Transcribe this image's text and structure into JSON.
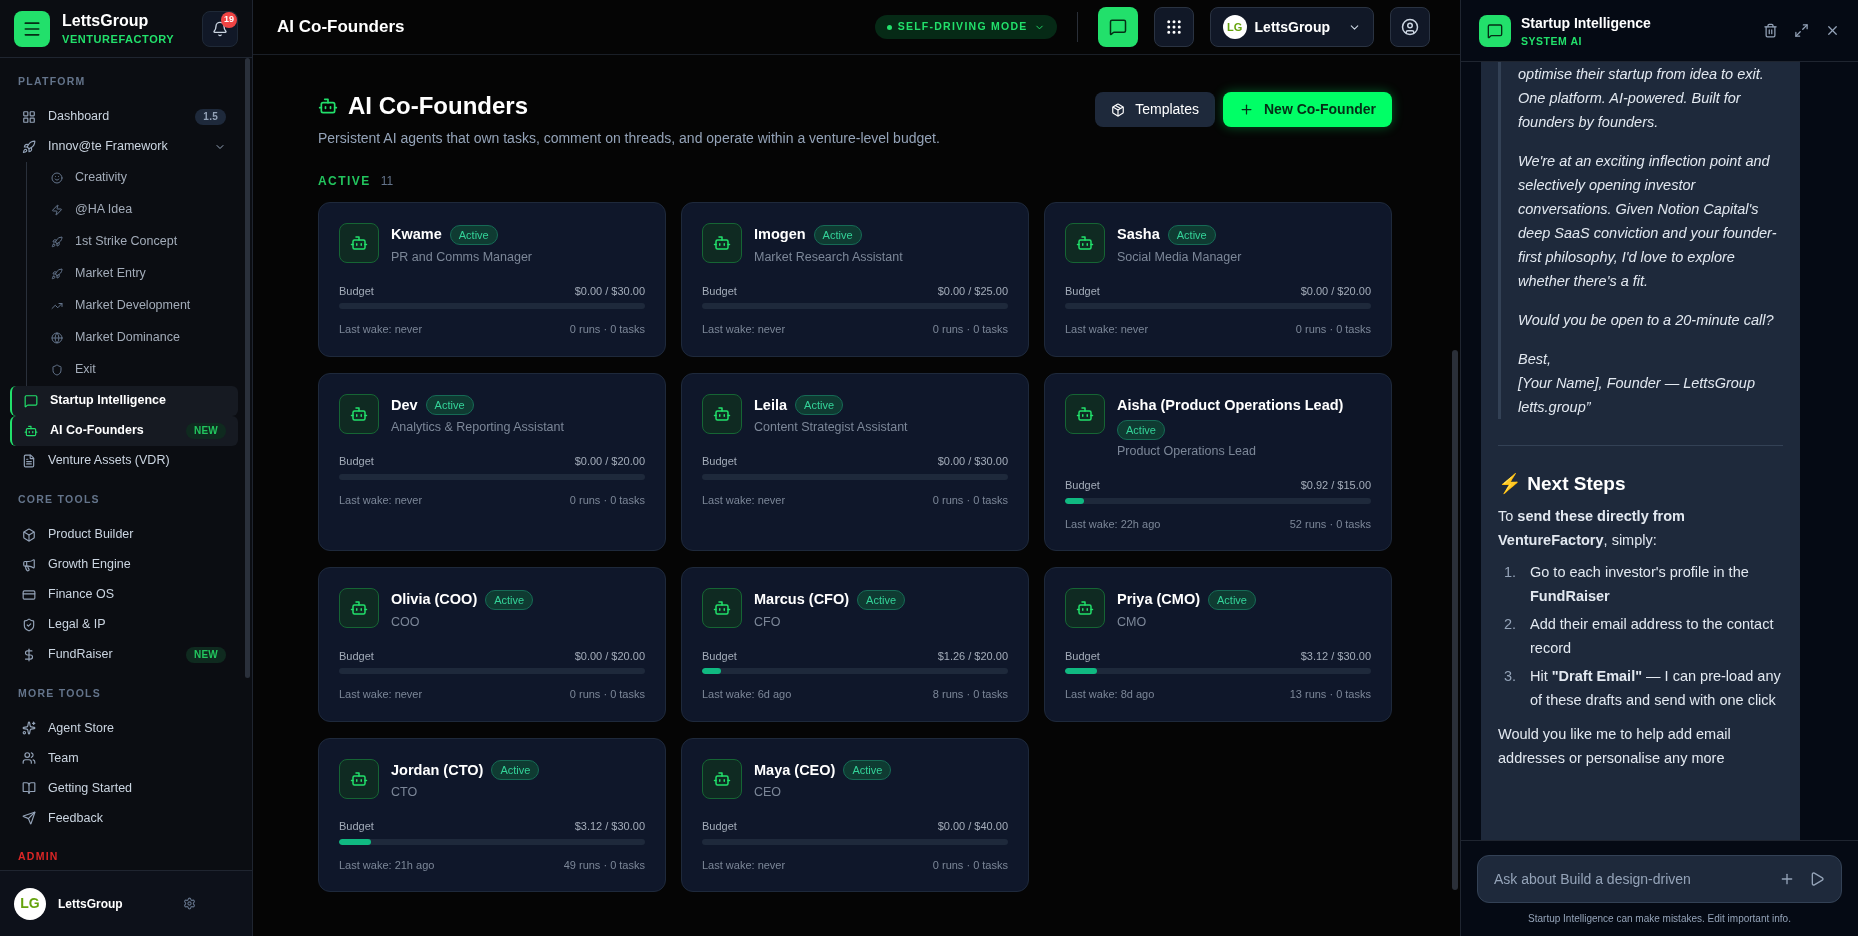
{
  "brand": {
    "name": "LettsGroup",
    "subtitle": "VENTUREFACTORY",
    "notifications": "19"
  },
  "sidebar": {
    "sections": [
      {
        "title": "PLATFORM",
        "color": "#64748b",
        "items": [
          {
            "label": "Dashboard",
            "selected": false,
            "badge": {
              "text": "1.5",
              "kind": "version"
            }
          },
          {
            "label": "Innov@te Framework",
            "selected": false,
            "expanded": true,
            "children": [
              {
                "label": "Creativity"
              },
              {
                "label": "@HA Idea"
              },
              {
                "label": "1st Strike Concept"
              },
              {
                "label": "Market Entry"
              },
              {
                "label": "Market Development"
              },
              {
                "label": "Market Dominance"
              },
              {
                "label": "Exit"
              }
            ]
          },
          {
            "label": "Startup Intelligence",
            "selected": true
          },
          {
            "label": "AI Co-Founders",
            "selected": true,
            "badge": {
              "text": "NEW",
              "kind": "new"
            }
          },
          {
            "label": "Venture Assets (VDR)",
            "selected": false
          }
        ]
      },
      {
        "title": "CORE TOOLS",
        "color": "#64748b",
        "items": [
          {
            "label": "Product Builder",
            "selected": false
          },
          {
            "label": "Growth Engine",
            "selected": false
          },
          {
            "label": "Finance OS",
            "selected": false
          },
          {
            "label": "Legal & IP",
            "selected": false
          },
          {
            "label": "FundRaiser",
            "selected": false,
            "badge": {
              "text": "NEW",
              "kind": "new"
            }
          }
        ]
      },
      {
        "title": "MORE TOOLS",
        "color": "#64748b",
        "items": [
          {
            "label": "Agent Store",
            "selected": false
          },
          {
            "label": "Team",
            "selected": false
          },
          {
            "label": "Getting Started",
            "selected": false
          },
          {
            "label": "Feedback",
            "selected": false
          }
        ]
      },
      {
        "title": "ADMIN",
        "color": "#dc2626"
      }
    ],
    "user": {
      "avatar": "LG",
      "name": "LettsGroup"
    }
  },
  "header": {
    "title": "AI Co-Founders",
    "mode": "SELF-DRIVING MODE",
    "chat_on": true,
    "account": {
      "avatar": "LG",
      "name": "LettsGroup"
    }
  },
  "page": {
    "title": "AI Co-Founders",
    "description": "Persistent AI agents that own tasks, comment on threads, and operate within a venture-level budget.",
    "buttons": [
      {
        "label": "Templates",
        "kind": "secondary"
      },
      {
        "label": "New Co-Founder",
        "kind": "primary"
      }
    ],
    "group": {
      "label": "ACTIVE",
      "count": "11"
    },
    "agents": [
      {
        "name": "Kwame",
        "status": "Active",
        "role": "PR and Comms Manager",
        "budget_label": "Budget",
        "budget": "$0.00 / $30.00",
        "last_wake": "Last wake: never",
        "stats": "0 runs · 0 tasks"
      },
      {
        "name": "Imogen",
        "status": "Active",
        "role": "Market Research Assistant",
        "budget_label": "Budget",
        "budget": "$0.00 / $25.00",
        "last_wake": "Last wake: never",
        "stats": "0 runs · 0 tasks"
      },
      {
        "name": "Sasha",
        "status": "Active",
        "role": "Social Media Manager",
        "budget_label": "Budget",
        "budget": "$0.00 / $20.00",
        "last_wake": "Last wake: never",
        "stats": "0 runs · 0 tasks"
      },
      {
        "name": "Dev",
        "status": "Active",
        "role": "Analytics & Reporting Assistant",
        "budget_label": "Budget",
        "budget": "$0.00 / $20.00",
        "last_wake": "Last wake: never",
        "stats": "0 runs · 0 tasks"
      },
      {
        "name": "Leila",
        "status": "Active",
        "role": "Content Strategist Assistant",
        "budget_label": "Budget",
        "budget": "$0.00 / $30.00",
        "last_wake": "Last wake: never",
        "stats": "0 runs · 0 tasks"
      },
      {
        "name": "Aisha (Product Operations Lead)",
        "status": "Active",
        "role": "Product Operations Lead",
        "budget_label": "Budget",
        "budget": "$0.92 / $15.00",
        "level": 0.061,
        "last_wake": "Last wake: 22h ago",
        "stats": "52 runs · 0 tasks"
      },
      {
        "name": "Olivia (COO)",
        "status": "Active",
        "role": "COO",
        "budget_label": "Budget",
        "budget": "$0.00 / $20.00",
        "last_wake": "Last wake: never",
        "stats": "0 runs · 0 tasks"
      },
      {
        "name": "Marcus (CFO)",
        "status": "Active",
        "role": "CFO",
        "budget_label": "Budget",
        "budget": "$1.26 / $20.00",
        "level": 0.063,
        "last_wake": "Last wake: 6d ago",
        "stats": "8 runs · 0 tasks"
      },
      {
        "name": "Priya (CMO)",
        "status": "Active",
        "role": "CMO",
        "budget_label": "Budget",
        "budget": "$3.12 / $30.00",
        "level": 0.104,
        "last_wake": "Last wake: 8d ago",
        "stats": "13 runs · 0 tasks"
      },
      {
        "name": "Jordan (CTO)",
        "status": "Active",
        "role": "CTO",
        "budget_label": "Budget",
        "budget": "$3.12 / $30.00",
        "level": 0.104,
        "last_wake": "Last wake: 21h ago",
        "stats": "49 runs · 0 tasks"
      },
      {
        "name": "Maya (CEO)",
        "status": "Active",
        "role": "CEO",
        "budget_label": "Budget",
        "budget": "$0.00 / $40.00",
        "last_wake": "Last wake: never",
        "stats": "0 runs · 0 tasks"
      }
    ]
  },
  "chat": {
    "title": "Startup Intelligence",
    "subtitle": "SYSTEM AI",
    "quote": [
      "optimise their startup from idea to exit. One platform. AI-powered. Built for founders by founders.",
      "We're at an exciting inflection point and selectively opening investor conversations. Given Notion Capital's deep SaaS conviction and your founder-first philosophy, I'd love to explore whether there's a fit.",
      "Would you be open to a 20-minute call?",
      "Best,\n[Your Name], Founder — LettsGroup\nletts.group”"
    ],
    "heading": "⚡ Next Steps",
    "intro": "To **send these directly from VentureFactory**, simply:",
    "steps": [
      {
        "num": "1.",
        "text": "Go to each investor's profile in the **FundRaiser**"
      },
      {
        "num": "2.",
        "text": "Add their email address to the contact record"
      },
      {
        "num": "3.",
        "text": "Hit **\"Draft Email\"** — I can pre-load any of these drafts and send with one click"
      }
    ],
    "closing": "Would you like me to help add email addresses or personalise any more",
    "input_placeholder": "Ask about Build a design-driven",
    "disclaimer": "Startup Intelligence can make mistakes. Edit important info."
  }
}
